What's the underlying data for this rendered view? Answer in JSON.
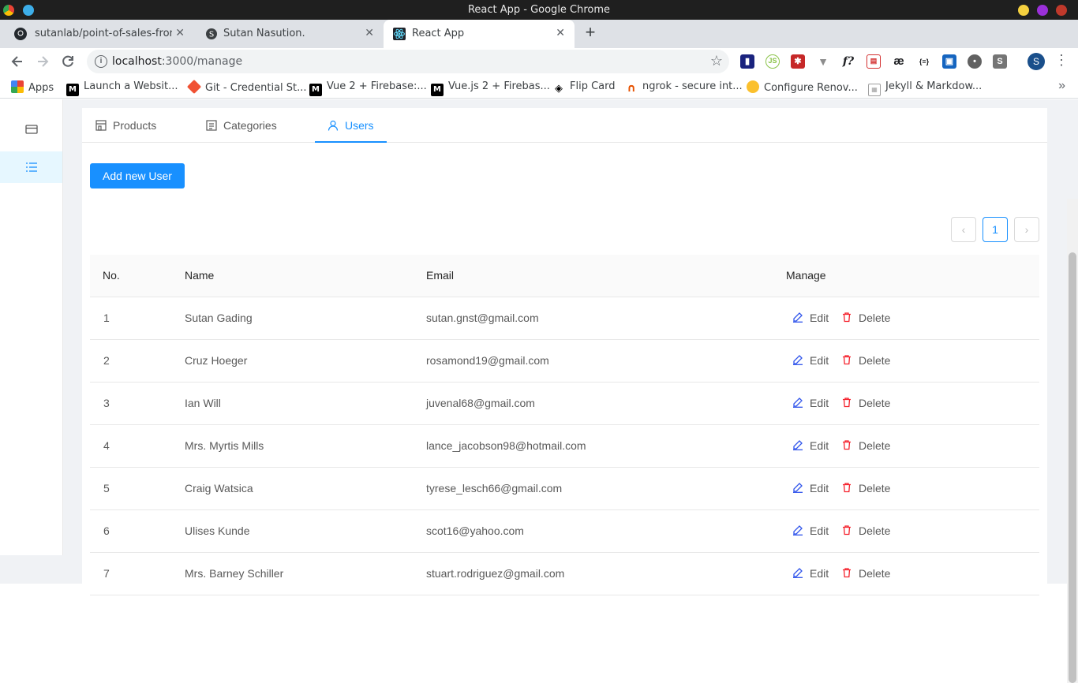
{
  "window": {
    "title": "React App - Google Chrome"
  },
  "tabs": [
    {
      "label": "sutanlab/point-of-sales-front",
      "icon": "github-icon"
    },
    {
      "label": "Sutan Nasution.",
      "icon": "site-s-icon"
    },
    {
      "label": "React App",
      "icon": "react-icon"
    }
  ],
  "tab_close": "✕",
  "new_tab": "+",
  "toolbar": {
    "url_host": "localhost",
    "url_path": ":3000/manage",
    "profile_initial": "S"
  },
  "bookmarks": [
    {
      "label": "Apps",
      "icon": "apps-grid-icon"
    },
    {
      "label": "Launch a Websit...",
      "icon": "medium-icon"
    },
    {
      "label": "Git - Credential St...",
      "icon": "git-icon"
    },
    {
      "label": "Vue 2 + Firebase:...",
      "icon": "medium-icon"
    },
    {
      "label": "Vue.js 2 + Firebas...",
      "icon": "medium-icon"
    },
    {
      "label": "Flip Card",
      "icon": "codepen-icon"
    },
    {
      "label": "ngrok - secure int...",
      "icon": "ngrok-icon"
    },
    {
      "label": "Configure Renov...",
      "icon": "renovate-icon"
    },
    {
      "label": "Jekyll & Markdow...",
      "icon": "jekyll-icon"
    }
  ],
  "page_tabs": [
    {
      "label": "Products",
      "icon": "shop-icon"
    },
    {
      "label": "Categories",
      "icon": "profile-icon"
    },
    {
      "label": "Users",
      "icon": "user-icon"
    }
  ],
  "add_button": "Add new User",
  "pagination": {
    "prev": "‹",
    "current": "1",
    "next": "›"
  },
  "table": {
    "headers": [
      "No.",
      "Name",
      "Email",
      "Manage"
    ],
    "edit_label": "Edit",
    "delete_label": "Delete",
    "rows": [
      {
        "no": "1",
        "name": "Sutan Gading",
        "email": "sutan.gnst@gmail.com"
      },
      {
        "no": "2",
        "name": "Cruz Hoeger",
        "email": "rosamond19@gmail.com"
      },
      {
        "no": "3",
        "name": "Ian Will",
        "email": "juvenal68@gmail.com"
      },
      {
        "no": "4",
        "name": "Mrs. Myrtis Mills",
        "email": "lance_jacobson98@hotmail.com"
      },
      {
        "no": "5",
        "name": "Craig Watsica",
        "email": "tyrese_lesch66@gmail.com"
      },
      {
        "no": "6",
        "name": "Ulises Kunde",
        "email": "scot16@yahoo.com"
      },
      {
        "no": "7",
        "name": "Mrs. Barney Schiller",
        "email": "stuart.rodriguez@gmail.com"
      }
    ]
  },
  "colors": {
    "primary": "#1890ff",
    "edit": "#2f54eb",
    "delete": "#f5222d"
  }
}
